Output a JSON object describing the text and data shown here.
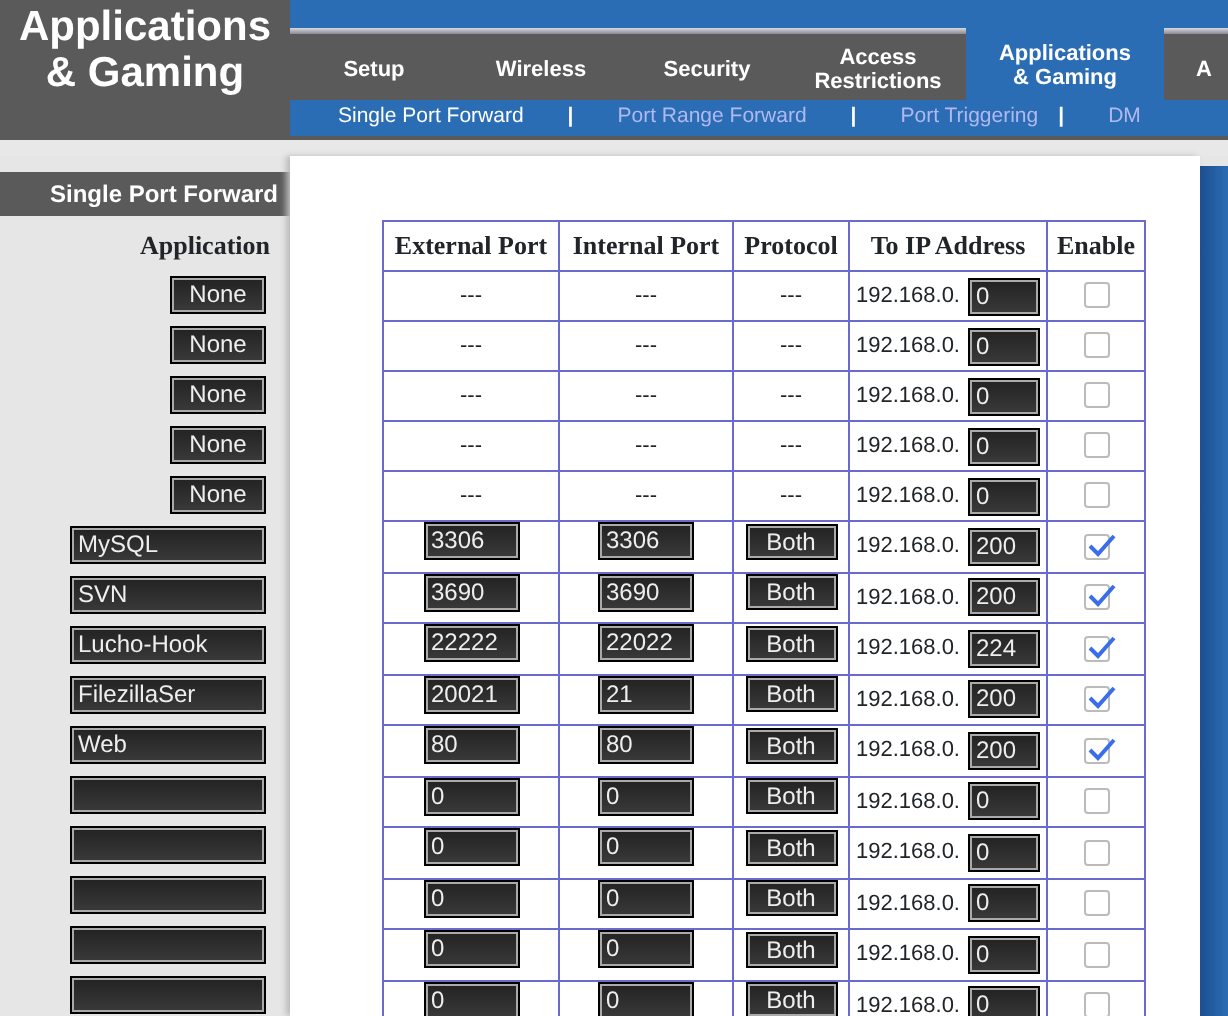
{
  "page_title": "Applications & Gaming",
  "tabs": [
    {
      "label": "Setup",
      "selected": false
    },
    {
      "label": "Wireless",
      "selected": false
    },
    {
      "label": "Security",
      "selected": false
    },
    {
      "label": "Access Restrictions",
      "selected": false
    },
    {
      "label": "Applications & Gaming",
      "selected": true
    },
    {
      "label": "A",
      "selected": false
    }
  ],
  "subnav": [
    {
      "kind": "link",
      "label": "Single Port Forward",
      "selected": true
    },
    {
      "kind": "separator",
      "label": "|"
    },
    {
      "kind": "link",
      "label": "Port Range Forward",
      "selected": false
    },
    {
      "kind": "separator",
      "label": "|"
    },
    {
      "kind": "link",
      "label": "Port Triggering",
      "selected": false
    },
    {
      "kind": "separator",
      "label": "|"
    },
    {
      "kind": "link",
      "label": "DM",
      "selected": false
    }
  ],
  "sidebar": {
    "section_title": "Single Port Forward",
    "column_heading": "Application"
  },
  "table": {
    "columns": [
      "External Port",
      "Internal Port",
      "Protocol",
      "To IP Address",
      "Enable"
    ],
    "rows": [
      {
        "kind": "fixed",
        "application": "None",
        "external_port": "---",
        "internal_port": "---",
        "protocol": "---",
        "ip_prefix": "192.168.0.",
        "ip_last": "0",
        "enabled": false
      },
      {
        "kind": "fixed",
        "application": "None",
        "external_port": "---",
        "internal_port": "---",
        "protocol": "---",
        "ip_prefix": "192.168.0.",
        "ip_last": "0",
        "enabled": false
      },
      {
        "kind": "fixed",
        "application": "None",
        "external_port": "---",
        "internal_port": "---",
        "protocol": "---",
        "ip_prefix": "192.168.0.",
        "ip_last": "0",
        "enabled": false
      },
      {
        "kind": "fixed",
        "application": "None",
        "external_port": "---",
        "internal_port": "---",
        "protocol": "---",
        "ip_prefix": "192.168.0.",
        "ip_last": "0",
        "enabled": false
      },
      {
        "kind": "fixed",
        "application": "None",
        "external_port": "---",
        "internal_port": "---",
        "protocol": "---",
        "ip_prefix": "192.168.0.",
        "ip_last": "0",
        "enabled": false
      },
      {
        "kind": "custom",
        "application": "MySQL",
        "external_port": "3306",
        "internal_port": "3306",
        "protocol": "Both",
        "ip_prefix": "192.168.0.",
        "ip_last": "200",
        "enabled": true
      },
      {
        "kind": "custom",
        "application": "SVN",
        "external_port": "3690",
        "internal_port": "3690",
        "protocol": "Both",
        "ip_prefix": "192.168.0.",
        "ip_last": "200",
        "enabled": true
      },
      {
        "kind": "custom",
        "application": "Lucho-Hook",
        "external_port": "22222",
        "internal_port": "22022",
        "protocol": "Both",
        "ip_prefix": "192.168.0.",
        "ip_last": "224",
        "enabled": true
      },
      {
        "kind": "custom",
        "application": "FilezillaSer",
        "external_port": "20021",
        "internal_port": "21",
        "protocol": "Both",
        "ip_prefix": "192.168.0.",
        "ip_last": "200",
        "enabled": true
      },
      {
        "kind": "custom",
        "application": "Web",
        "external_port": "80",
        "internal_port": "80",
        "protocol": "Both",
        "ip_prefix": "192.168.0.",
        "ip_last": "200",
        "enabled": true
      },
      {
        "kind": "custom",
        "external_port": "0",
        "internal_port": "0",
        "protocol": "Both",
        "ip_prefix": "192.168.0.",
        "ip_last": "0",
        "enabled": false
      },
      {
        "kind": "custom",
        "external_port": "0",
        "internal_port": "0",
        "protocol": "Both",
        "ip_prefix": "192.168.0.",
        "ip_last": "0",
        "enabled": false
      },
      {
        "kind": "custom",
        "external_port": "0",
        "internal_port": "0",
        "protocol": "Both",
        "ip_prefix": "192.168.0.",
        "ip_last": "0",
        "enabled": false
      },
      {
        "kind": "custom",
        "external_port": "0",
        "internal_port": "0",
        "protocol": "Both",
        "ip_prefix": "192.168.0.",
        "ip_last": "0",
        "enabled": false
      },
      {
        "kind": "custom",
        "external_port": "0",
        "internal_port": "0",
        "protocol": "Both",
        "ip_prefix": "192.168.0.",
        "ip_last": "0",
        "enabled": false
      }
    ]
  }
}
